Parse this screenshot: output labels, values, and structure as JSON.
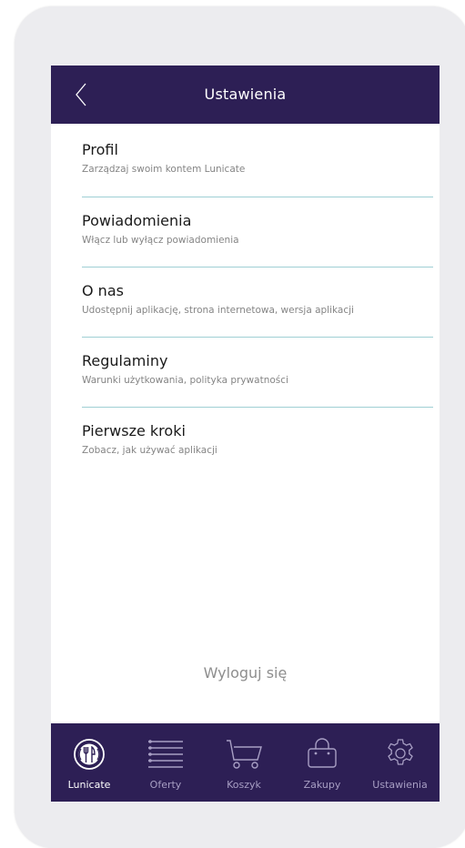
{
  "header": {
    "title": "Ustawienia",
    "back_icon": "chevron-left-icon"
  },
  "menu": {
    "items": [
      {
        "title": "Profil",
        "subtitle": "Zarządzaj swoim kontem Lunicate"
      },
      {
        "title": "Powiadomienia",
        "subtitle": "Włącz lub wyłącz powiadomienia"
      },
      {
        "title": "O nas",
        "subtitle": "Udostępnij aplikację, strona internetowa, wersja aplikacji"
      },
      {
        "title": "Regulaminy",
        "subtitle": "Warunki użytkowania, polityka prywatności"
      },
      {
        "title": "Pierwsze kroki",
        "subtitle": "Zobacz, jak używać aplikacji"
      }
    ]
  },
  "logout_label": "Wyloguj się",
  "tabbar": {
    "tabs": [
      {
        "label": "Lunicate",
        "icon": "lunicate-logo-icon",
        "active": true
      },
      {
        "label": "Oferty",
        "icon": "list-icon",
        "active": false
      },
      {
        "label": "Koszyk",
        "icon": "cart-icon",
        "active": false
      },
      {
        "label": "Zakupy",
        "icon": "shopping-bag-icon",
        "active": false
      },
      {
        "label": "Ustawienia",
        "icon": "gear-icon",
        "active": false
      }
    ]
  },
  "colors": {
    "header_bg": "#2d1f55",
    "divider": "#9fcfd4",
    "tab_inactive": "#a89fc4"
  }
}
